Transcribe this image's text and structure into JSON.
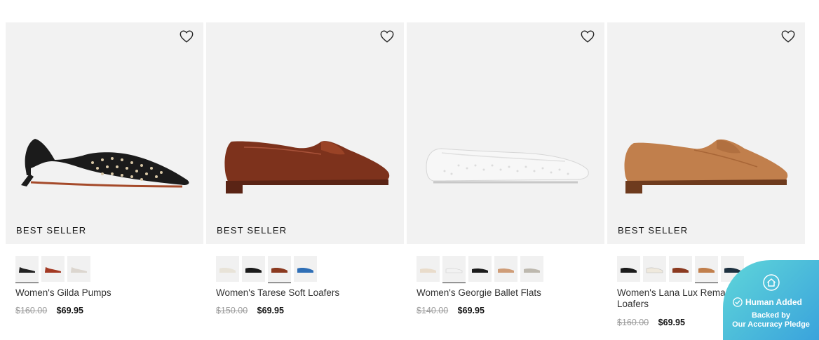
{
  "products": [
    {
      "badge": "BEST SELLER",
      "name": "Women's Gilda Pumps",
      "original_price": "$160.00",
      "sale_price": "$69.95",
      "shoe_color": "#1b1b1b",
      "swatches": [
        "#222222",
        "#a33a24",
        "#dcd6cf"
      ]
    },
    {
      "badge": "BEST SELLER",
      "name": "Women's Tarese Soft Loafers",
      "original_price": "$150.00",
      "sale_price": "$69.95",
      "shoe_color": "#7d321c",
      "swatches": [
        "#e8e3d8",
        "#1b1b1b",
        "#8b3a20",
        "#2f6fb6"
      ]
    },
    {
      "badge": "",
      "name": "Women's Georgie Ballet Flats",
      "original_price": "$140.00",
      "sale_price": "$69.95",
      "shoe_color": "#f4f4f4",
      "swatches": [
        "#e9dccb",
        "#f2f2f2",
        "#1b1b1b",
        "#cf9d78",
        "#bdb8ae"
      ]
    },
    {
      "badge": "BEST SELLER",
      "name": "Women's Lana Lux Remastered Penny Loafers",
      "original_price": "$160.00",
      "sale_price": "$69.95",
      "shoe_color": "#c17f4c",
      "swatches": [
        "#1b1b1b",
        "#efe9dd",
        "#8b3a20",
        "#c17f4c",
        "#1e3140"
      ]
    }
  ],
  "pledge": {
    "title": "Human Added",
    "line1": "Backed by",
    "line2": "Our Accuracy Pledge"
  },
  "icons": {
    "wishlist": "heart-outline-icon",
    "pledge_home": "house-icon",
    "pledge_check": "check-circle-icon"
  }
}
